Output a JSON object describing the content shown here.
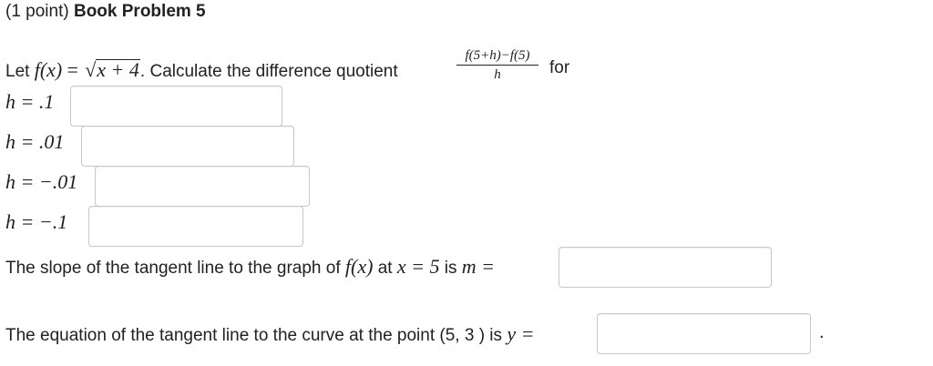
{
  "problem": {
    "points": "(1 point)",
    "title": "Book Problem 5"
  },
  "statement": {
    "let_text": "Let",
    "fx": "f(x)",
    "equals": "=",
    "sqrt_symbol": "√",
    "radicand": "x + 4",
    "after_sqrt": ". Calculate the difference quotient",
    "quotient_numerator": "f(5+h)−f(5)",
    "quotient_denominator": "h",
    "for_text": "for"
  },
  "h_rows": [
    {
      "label": "h = .1",
      "value": ""
    },
    {
      "label": "h = .01",
      "value": ""
    },
    {
      "label": "h = −.01",
      "value": ""
    },
    {
      "label": "h = −.1",
      "value": ""
    }
  ],
  "slope": {
    "text": "The slope of the tangent line to the graph of",
    "fx": "f(x)",
    "at_text": "at",
    "x_equals": "x = 5",
    "is_text": "is",
    "m_equals": "m =",
    "value": ""
  },
  "tangent": {
    "text": "The equation of the tangent line to the curve at the point (5, 3 ) is",
    "y_equals": "y =",
    "value": "",
    "period": "."
  }
}
